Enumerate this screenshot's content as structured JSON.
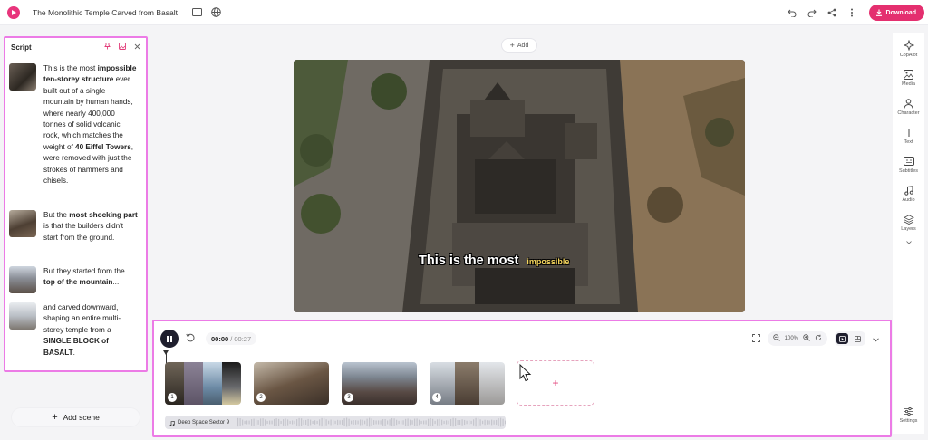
{
  "header": {
    "title": "The Monolithic Temple Carved from Basalt",
    "download_label": "Download"
  },
  "script_panel": {
    "title": "Script",
    "scenes": [
      {
        "parts": [
          {
            "text": "This is the most ",
            "bold": false
          },
          {
            "text": "impossible ten-storey structure",
            "bold": true
          },
          {
            "text": " ever built out of a single mountain by human hands, where nearly 400,000 tonnes of solid volcanic rock, which matches the weight of ",
            "bold": false
          },
          {
            "text": "40 Eiffel Towers",
            "bold": true
          },
          {
            "text": ", were removed with just the strokes of hammers and chisels.",
            "bold": false
          }
        ]
      },
      {
        "parts": [
          {
            "text": "But the ",
            "bold": false
          },
          {
            "text": "most shocking part",
            "bold": true
          },
          {
            "text": " is that the builders didn't start from the ground.",
            "bold": false
          }
        ]
      },
      {
        "parts": [
          {
            "text": "But they started from the ",
            "bold": false
          },
          {
            "text": "top of the mountain",
            "bold": true
          },
          {
            "text": "...",
            "bold": false
          }
        ]
      },
      {
        "parts": [
          {
            "text": "and carved downward, shaping an entire multi-storey temple from a ",
            "bold": false
          },
          {
            "text": "SINGLE BLOCK of BASALT",
            "bold": true
          },
          {
            "text": ".",
            "bold": false
          }
        ]
      }
    ],
    "add_scene_label": "Add scene"
  },
  "canvas": {
    "add_label": "Add",
    "caption_main": "This is the most",
    "caption_highlight": "impossible"
  },
  "rail": {
    "items": [
      {
        "label": "CopAlot",
        "icon": "sparkle-icon"
      },
      {
        "label": "Media",
        "icon": "image-icon"
      },
      {
        "label": "Character",
        "icon": "person-icon"
      },
      {
        "label": "Text",
        "icon": "text-icon"
      },
      {
        "label": "Subtitles",
        "icon": "subtitles-icon"
      },
      {
        "label": "Audio",
        "icon": "music-icon"
      },
      {
        "label": "Layers",
        "icon": "layers-icon"
      }
    ],
    "settings_label": "Settings"
  },
  "timeline": {
    "current_time": "00:00",
    "total_time": "/ 00:27",
    "zoom": "100%",
    "clips": [
      "1",
      "2",
      "3",
      "4"
    ],
    "audio_track": "Deep Space Sector 9"
  },
  "colors": {
    "accent": "#e42f6f",
    "highlight_border": "#ec7be6",
    "dark": "#1f1f2e"
  }
}
